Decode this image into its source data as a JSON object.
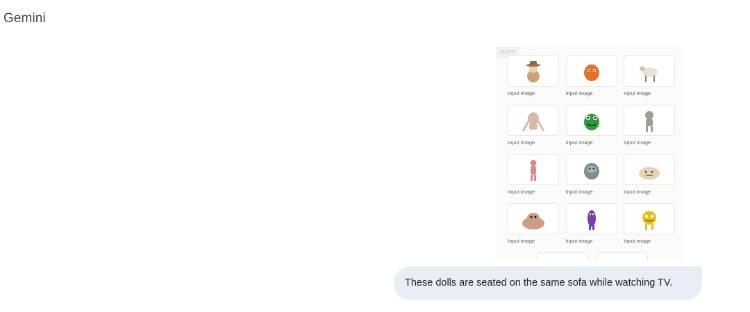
{
  "app": {
    "title": "Gemini"
  },
  "attachment": {
    "tag": "WHITE",
    "items": [
      {
        "caption": "Input image",
        "icon": "straw-hat-doll-icon",
        "color": "#c9a37a"
      },
      {
        "caption": "Input image",
        "icon": "orange-fluffy-monster-icon",
        "color": "#e0722a"
      },
      {
        "caption": "Input image",
        "icon": "sheep-doll-icon",
        "color": "#e9e3d6"
      },
      {
        "caption": "Input image",
        "icon": "pink-crouching-creature-icon",
        "color": "#d8b8ae"
      },
      {
        "caption": "Input image",
        "icon": "green-monster-icon",
        "color": "#2f9a3a"
      },
      {
        "caption": "Input image",
        "icon": "gray-goblin-icon",
        "color": "#9a9f94"
      },
      {
        "caption": "Input image",
        "icon": "pink-slender-doll-icon",
        "color": "#d98a8a"
      },
      {
        "caption": "Input image",
        "icon": "gray-furry-creature-icon",
        "color": "#7f8d93"
      },
      {
        "caption": "Input image",
        "icon": "beige-fluffy-blob-icon",
        "color": "#e4d3b4"
      },
      {
        "caption": "Input image",
        "icon": "pink-furry-creature-icon",
        "color": "#cf9c8a"
      },
      {
        "caption": "Input image",
        "icon": "purple-doll-icon",
        "color": "#7b3fb0"
      },
      {
        "caption": "Input image",
        "icon": "yellow-monster-icon",
        "color": "#e6bf22"
      }
    ],
    "partial": [
      {
        "icon": "fluffy-doll-partial-icon",
        "color": "#b8a989"
      },
      {
        "icon": "yellow-doll-partial-icon",
        "color": "#d8c03a"
      }
    ]
  },
  "message": {
    "text": "These dolls are seated on the same sofa while watching TV.",
    "bubble_color": "#e9eef6"
  }
}
